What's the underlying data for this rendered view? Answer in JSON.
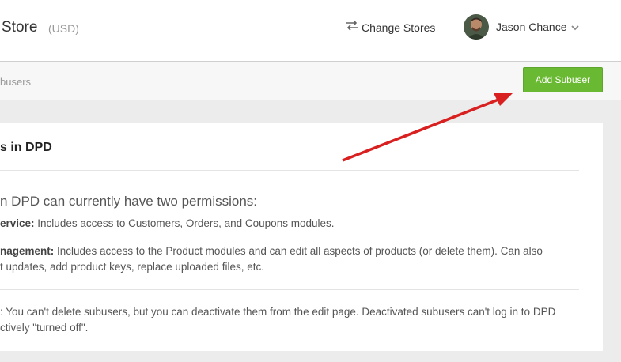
{
  "header": {
    "store_title": "Store",
    "currency": "(USD)",
    "change_stores_label": "Change Stores",
    "user_name": "Jason Chance"
  },
  "subbar": {
    "breadcrumb": "busers",
    "add_subuser_label": "Add Subuser"
  },
  "card": {
    "title": "s in DPD",
    "intro": "n DPD can currently have two permissions:",
    "perm1_label": "ervice:",
    "perm1_text": " Includes access to Customers, Orders, and Coupons modules.",
    "perm2_label": "nagement:",
    "perm2_line1": " Includes access to the Product modules and can edit all aspects of products (or delete them). Can also",
    "perm2_line2": "t updates, add product keys, replace uploaded files, etc.",
    "note_line1": ": You can't delete subusers, but you can deactivate them from the edit page. Deactivated subusers can't log in to DPD",
    "note_line2": "ctively \"turned off\"."
  },
  "colors": {
    "accent_green": "#6ab932",
    "annotation_arrow": "#d92020"
  }
}
